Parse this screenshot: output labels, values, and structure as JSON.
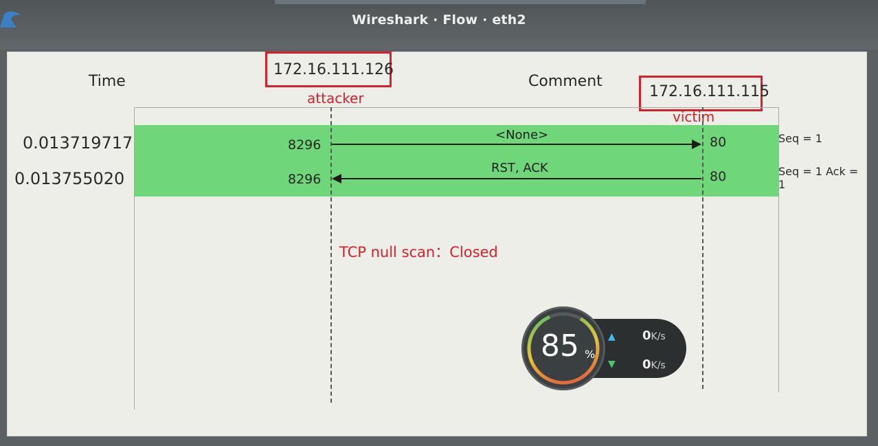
{
  "window": {
    "title": "Wireshark · Flow · eth2"
  },
  "header": {
    "time_label": "Time",
    "comment_label": "Comment",
    "host_a": "172.16.111.126",
    "host_b": "172.16.111.115"
  },
  "notes": {
    "host_a_role": "attacker",
    "host_b_role": "victim",
    "scan_result": "TCP null scan：Closed"
  },
  "flows": [
    {
      "time": "0.013719717",
      "src_port": "8296",
      "dst_port": "80",
      "message": "<None>",
      "direction": "right",
      "comment": "Seq = 1"
    },
    {
      "time": "0.013755020",
      "src_port": "8296",
      "dst_port": "80",
      "message": "RST, ACK",
      "direction": "left",
      "comment": "Seq = 1 Ack = 1"
    }
  ],
  "overlay": {
    "percent": "85",
    "percent_unit": "%",
    "upload": "0",
    "download": "0",
    "rate_unit": "K/s",
    "icons": [
      "up-arrow-icon",
      "down-arrow-icon"
    ]
  },
  "colors": {
    "row_highlight": "#6fd67a",
    "annotation": "#d8202c"
  }
}
